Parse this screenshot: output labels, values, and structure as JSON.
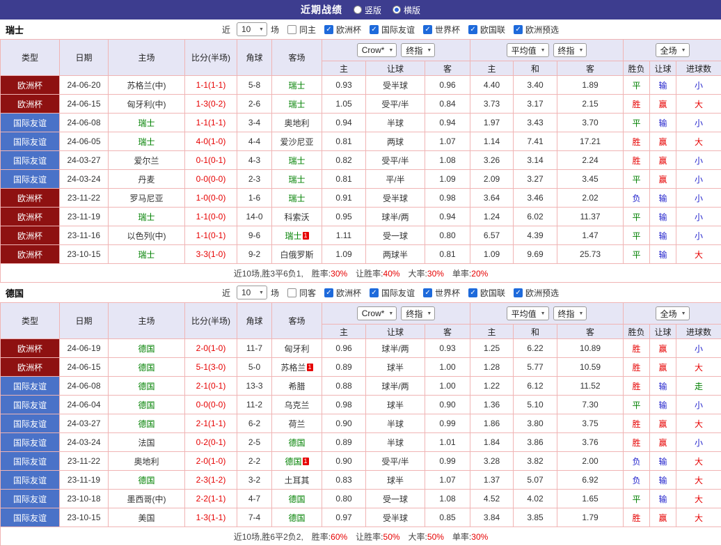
{
  "topbar": {
    "title": "近期战绩",
    "radio_vertical": "竖版",
    "radio_horizontal": "横版",
    "selected": "横版"
  },
  "header_controls": {
    "near": "近",
    "rounds": "10",
    "games": "场",
    "bookmaker": "Crow*",
    "final_index": "终指",
    "average": "平均值",
    "full_match": "全场"
  },
  "columns": {
    "left": [
      "类型",
      "日期",
      "主场",
      "比分(半场)",
      "角球",
      "客场"
    ],
    "sub": [
      "主",
      "让球",
      "客",
      "主",
      "和",
      "客",
      "胜负",
      "让球",
      "进球数"
    ]
  },
  "competitions": [
    "欧洲杯",
    "国际友谊",
    "世界杯",
    "欧国联",
    "欧洲预选"
  ],
  "colors": {
    "topbar_bg": "#3d3d8f",
    "euro_competition": "#8e1111",
    "friendly_competition": "#4a72c8",
    "header_bg": "#e6e6f5",
    "grid_border": "#f0b4b4",
    "win_red": "#e60000",
    "draw_green": "#008000",
    "lose_blue": "#2323cc"
  },
  "sections": [
    {
      "team": "瑞士",
      "same_filter": "同主",
      "rows": [
        {
          "comp": "欧洲杯",
          "comp_type": "euro",
          "date": "24-06-20",
          "home": "苏格兰(中)",
          "home_focus": false,
          "score": "1-1(1-1)",
          "corners": "5-8",
          "away": "瑞士",
          "away_focus": true,
          "crown": [
            "0.93",
            "受半球",
            "0.96"
          ],
          "avg": [
            "4.40",
            "3.40",
            "1.89"
          ],
          "results": [
            {
              "t": "平",
              "c": "green"
            },
            {
              "t": "输",
              "c": "blue"
            },
            {
              "t": "小",
              "c": "blue"
            }
          ]
        },
        {
          "comp": "欧洲杯",
          "comp_type": "euro",
          "date": "24-06-15",
          "home": "匈牙利(中)",
          "home_focus": false,
          "score": "1-3(0-2)",
          "corners": "2-6",
          "away": "瑞士",
          "away_focus": true,
          "crown": [
            "1.05",
            "受平/半",
            "0.84"
          ],
          "avg": [
            "3.73",
            "3.17",
            "2.15"
          ],
          "results": [
            {
              "t": "胜",
              "c": "red"
            },
            {
              "t": "赢",
              "c": "red"
            },
            {
              "t": "大",
              "c": "red"
            }
          ]
        },
        {
          "comp": "国际友谊",
          "comp_type": "friendly",
          "date": "24-06-08",
          "home": "瑞士",
          "home_focus": true,
          "score": "1-1(1-1)",
          "corners": "3-4",
          "away": "奥地利",
          "away_focus": false,
          "crown": [
            "0.94",
            "半球",
            "0.94"
          ],
          "avg": [
            "1.97",
            "3.43",
            "3.70"
          ],
          "results": [
            {
              "t": "平",
              "c": "green"
            },
            {
              "t": "输",
              "c": "blue"
            },
            {
              "t": "小",
              "c": "blue"
            }
          ]
        },
        {
          "comp": "国际友谊",
          "comp_type": "friendly",
          "date": "24-06-05",
          "home": "瑞士",
          "home_focus": true,
          "score": "4-0(1-0)",
          "corners": "4-4",
          "away": "爱沙尼亚",
          "away_focus": false,
          "crown": [
            "0.81",
            "两球",
            "1.07"
          ],
          "avg": [
            "1.14",
            "7.41",
            "17.21"
          ],
          "results": [
            {
              "t": "胜",
              "c": "red"
            },
            {
              "t": "赢",
              "c": "red"
            },
            {
              "t": "大",
              "c": "red"
            }
          ]
        },
        {
          "comp": "国际友谊",
          "comp_type": "friendly",
          "date": "24-03-27",
          "home": "爱尔兰",
          "home_focus": false,
          "score": "0-1(0-1)",
          "corners": "4-3",
          "away": "瑞士",
          "away_focus": true,
          "crown": [
            "0.82",
            "受平/半",
            "1.08"
          ],
          "avg": [
            "3.26",
            "3.14",
            "2.24"
          ],
          "results": [
            {
              "t": "胜",
              "c": "red"
            },
            {
              "t": "赢",
              "c": "red"
            },
            {
              "t": "小",
              "c": "blue"
            }
          ]
        },
        {
          "comp": "国际友谊",
          "comp_type": "friendly",
          "date": "24-03-24",
          "home": "丹麦",
          "home_focus": false,
          "score": "0-0(0-0)",
          "corners": "2-3",
          "away": "瑞士",
          "away_focus": true,
          "crown": [
            "0.81",
            "平/半",
            "1.09"
          ],
          "avg": [
            "2.09",
            "3.27",
            "3.45"
          ],
          "results": [
            {
              "t": "平",
              "c": "green"
            },
            {
              "t": "赢",
              "c": "red"
            },
            {
              "t": "小",
              "c": "blue"
            }
          ]
        },
        {
          "comp": "欧洲杯",
          "comp_type": "euro",
          "date": "23-11-22",
          "home": "罗马尼亚",
          "home_focus": false,
          "score": "1-0(0-0)",
          "corners": "1-6",
          "away": "瑞士",
          "away_focus": true,
          "crown": [
            "0.91",
            "受半球",
            "0.98"
          ],
          "avg": [
            "3.64",
            "3.46",
            "2.02"
          ],
          "results": [
            {
              "t": "负",
              "c": "blue"
            },
            {
              "t": "输",
              "c": "blue"
            },
            {
              "t": "小",
              "c": "blue"
            }
          ]
        },
        {
          "comp": "欧洲杯",
          "comp_type": "euro",
          "date": "23-11-19",
          "home": "瑞士",
          "home_focus": true,
          "score": "1-1(0-0)",
          "corners": "14-0",
          "away": "科索沃",
          "away_focus": false,
          "crown": [
            "0.95",
            "球半/两",
            "0.94"
          ],
          "avg": [
            "1.24",
            "6.02",
            "11.37"
          ],
          "results": [
            {
              "t": "平",
              "c": "green"
            },
            {
              "t": "输",
              "c": "blue"
            },
            {
              "t": "小",
              "c": "blue"
            }
          ]
        },
        {
          "comp": "欧洲杯",
          "comp_type": "euro",
          "date": "23-11-16",
          "home": "以色列(中)",
          "home_focus": false,
          "score": "1-1(0-1)",
          "corners": "9-6",
          "away": "瑞士",
          "away_focus": true,
          "away_card": "1",
          "crown": [
            "1.11",
            "受一球",
            "0.80"
          ],
          "avg": [
            "6.57",
            "4.39",
            "1.47"
          ],
          "results": [
            {
              "t": "平",
              "c": "green"
            },
            {
              "t": "输",
              "c": "blue"
            },
            {
              "t": "小",
              "c": "blue"
            }
          ]
        },
        {
          "comp": "欧洲杯",
          "comp_type": "euro",
          "date": "23-10-15",
          "home": "瑞士",
          "home_focus": true,
          "score": "3-3(1-0)",
          "corners": "9-2",
          "away": "白俄罗斯",
          "away_focus": false,
          "crown": [
            "1.09",
            "两球半",
            "0.81"
          ],
          "avg": [
            "1.09",
            "9.69",
            "25.73"
          ],
          "results": [
            {
              "t": "平",
              "c": "green"
            },
            {
              "t": "输",
              "c": "blue"
            },
            {
              "t": "大",
              "c": "red"
            }
          ]
        }
      ],
      "summary": {
        "record": "近10场,胜3平6负1,",
        "stats": [
          {
            "label": "胜率:",
            "value": "30%"
          },
          {
            "label": "让胜率:",
            "value": "40%"
          },
          {
            "label": "大率:",
            "value": "30%"
          },
          {
            "label": "单率:",
            "value": "20%"
          }
        ]
      }
    },
    {
      "team": "德国",
      "same_filter": "同客",
      "rows": [
        {
          "comp": "欧洲杯",
          "comp_type": "euro",
          "date": "24-06-19",
          "home": "德国",
          "home_focus": true,
          "score": "2-0(1-0)",
          "corners": "11-7",
          "away": "匈牙利",
          "away_focus": false,
          "crown": [
            "0.96",
            "球半/两",
            "0.93"
          ],
          "avg": [
            "1.25",
            "6.22",
            "10.89"
          ],
          "results": [
            {
              "t": "胜",
              "c": "red"
            },
            {
              "t": "赢",
              "c": "red"
            },
            {
              "t": "小",
              "c": "blue"
            }
          ]
        },
        {
          "comp": "欧洲杯",
          "comp_type": "euro",
          "date": "24-06-15",
          "home": "德国",
          "home_focus": true,
          "score": "5-1(3-0)",
          "corners": "5-0",
          "away": "苏格兰",
          "away_focus": false,
          "away_card": "1",
          "crown": [
            "0.89",
            "球半",
            "1.00"
          ],
          "avg": [
            "1.28",
            "5.77",
            "10.59"
          ],
          "results": [
            {
              "t": "胜",
              "c": "red"
            },
            {
              "t": "赢",
              "c": "red"
            },
            {
              "t": "大",
              "c": "red"
            }
          ]
        },
        {
          "comp": "国际友谊",
          "comp_type": "friendly",
          "date": "24-06-08",
          "home": "德国",
          "home_focus": true,
          "score": "2-1(0-1)",
          "corners": "13-3",
          "away": "希腊",
          "away_focus": false,
          "crown": [
            "0.88",
            "球半/两",
            "1.00"
          ],
          "avg": [
            "1.22",
            "6.12",
            "11.52"
          ],
          "results": [
            {
              "t": "胜",
              "c": "red"
            },
            {
              "t": "输",
              "c": "blue"
            },
            {
              "t": "走",
              "c": "green"
            }
          ]
        },
        {
          "comp": "国际友谊",
          "comp_type": "friendly",
          "date": "24-06-04",
          "home": "德国",
          "home_focus": true,
          "score": "0-0(0-0)",
          "corners": "11-2",
          "away": "乌克兰",
          "away_focus": false,
          "crown": [
            "0.98",
            "球半",
            "0.90"
          ],
          "avg": [
            "1.36",
            "5.10",
            "7.30"
          ],
          "results": [
            {
              "t": "平",
              "c": "green"
            },
            {
              "t": "输",
              "c": "blue"
            },
            {
              "t": "小",
              "c": "blue"
            }
          ]
        },
        {
          "comp": "国际友谊",
          "comp_type": "friendly",
          "date": "24-03-27",
          "home": "德国",
          "home_focus": true,
          "score": "2-1(1-1)",
          "corners": "6-2",
          "away": "荷兰",
          "away_focus": false,
          "crown": [
            "0.90",
            "半球",
            "0.99"
          ],
          "avg": [
            "1.86",
            "3.80",
            "3.75"
          ],
          "results": [
            {
              "t": "胜",
              "c": "red"
            },
            {
              "t": "赢",
              "c": "red"
            },
            {
              "t": "大",
              "c": "red"
            }
          ]
        },
        {
          "comp": "国际友谊",
          "comp_type": "friendly",
          "date": "24-03-24",
          "home": "法国",
          "home_focus": false,
          "score": "0-2(0-1)",
          "corners": "2-5",
          "away": "德国",
          "away_focus": true,
          "crown": [
            "0.89",
            "半球",
            "1.01"
          ],
          "avg": [
            "1.84",
            "3.86",
            "3.76"
          ],
          "results": [
            {
              "t": "胜",
              "c": "red"
            },
            {
              "t": "赢",
              "c": "red"
            },
            {
              "t": "小",
              "c": "blue"
            }
          ]
        },
        {
          "comp": "国际友谊",
          "comp_type": "friendly",
          "date": "23-11-22",
          "home": "奥地利",
          "home_focus": false,
          "score": "2-0(1-0)",
          "corners": "2-2",
          "away": "德国",
          "away_focus": true,
          "away_card": "1",
          "crown": [
            "0.90",
            "受平/半",
            "0.99"
          ],
          "avg": [
            "3.28",
            "3.82",
            "2.00"
          ],
          "results": [
            {
              "t": "负",
              "c": "blue"
            },
            {
              "t": "输",
              "c": "blue"
            },
            {
              "t": "大",
              "c": "red"
            }
          ]
        },
        {
          "comp": "国际友谊",
          "comp_type": "friendly",
          "date": "23-11-19",
          "home": "德国",
          "home_focus": true,
          "score": "2-3(1-2)",
          "corners": "3-2",
          "away": "土耳其",
          "away_focus": false,
          "crown": [
            "0.83",
            "球半",
            "1.07"
          ],
          "avg": [
            "1.37",
            "5.07",
            "6.92"
          ],
          "results": [
            {
              "t": "负",
              "c": "blue"
            },
            {
              "t": "输",
              "c": "blue"
            },
            {
              "t": "大",
              "c": "red"
            }
          ]
        },
        {
          "comp": "国际友谊",
          "comp_type": "friendly",
          "date": "23-10-18",
          "home": "墨西哥(中)",
          "home_focus": false,
          "score": "2-2(1-1)",
          "corners": "4-7",
          "away": "德国",
          "away_focus": true,
          "crown": [
            "0.80",
            "受一球",
            "1.08"
          ],
          "avg": [
            "4.52",
            "4.02",
            "1.65"
          ],
          "results": [
            {
              "t": "平",
              "c": "green"
            },
            {
              "t": "输",
              "c": "blue"
            },
            {
              "t": "大",
              "c": "red"
            }
          ]
        },
        {
          "comp": "国际友谊",
          "comp_type": "friendly",
          "date": "23-10-15",
          "home": "美国",
          "home_focus": false,
          "score": "1-3(1-1)",
          "corners": "7-4",
          "away": "德国",
          "away_focus": true,
          "crown": [
            "0.97",
            "受半球",
            "0.85"
          ],
          "avg": [
            "3.84",
            "3.85",
            "1.79"
          ],
          "results": [
            {
              "t": "胜",
              "c": "red"
            },
            {
              "t": "赢",
              "c": "red"
            },
            {
              "t": "大",
              "c": "red"
            }
          ]
        }
      ],
      "summary": {
        "record": "近10场,胜6平2负2,",
        "stats": [
          {
            "label": "胜率:",
            "value": "60%"
          },
          {
            "label": "让胜率:",
            "value": "50%"
          },
          {
            "label": "大率:",
            "value": "50%"
          },
          {
            "label": "单率:",
            "value": "30%"
          }
        ]
      }
    }
  ]
}
